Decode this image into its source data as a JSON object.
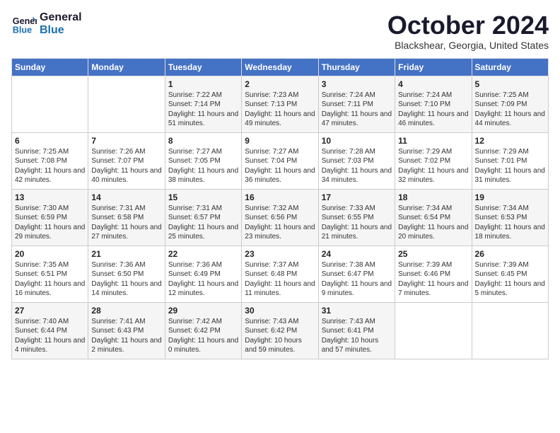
{
  "header": {
    "logo_line1": "General",
    "logo_line2": "Blue",
    "month_title": "October 2024",
    "location": "Blackshear, Georgia, United States"
  },
  "days_of_week": [
    "Sunday",
    "Monday",
    "Tuesday",
    "Wednesday",
    "Thursday",
    "Friday",
    "Saturday"
  ],
  "weeks": [
    [
      {
        "day": "",
        "info": ""
      },
      {
        "day": "",
        "info": ""
      },
      {
        "day": "1",
        "info": "Sunrise: 7:22 AM\nSunset: 7:14 PM\nDaylight: 11 hours and 51 minutes."
      },
      {
        "day": "2",
        "info": "Sunrise: 7:23 AM\nSunset: 7:13 PM\nDaylight: 11 hours and 49 minutes."
      },
      {
        "day": "3",
        "info": "Sunrise: 7:24 AM\nSunset: 7:11 PM\nDaylight: 11 hours and 47 minutes."
      },
      {
        "day": "4",
        "info": "Sunrise: 7:24 AM\nSunset: 7:10 PM\nDaylight: 11 hours and 46 minutes."
      },
      {
        "day": "5",
        "info": "Sunrise: 7:25 AM\nSunset: 7:09 PM\nDaylight: 11 hours and 44 minutes."
      }
    ],
    [
      {
        "day": "6",
        "info": "Sunrise: 7:25 AM\nSunset: 7:08 PM\nDaylight: 11 hours and 42 minutes."
      },
      {
        "day": "7",
        "info": "Sunrise: 7:26 AM\nSunset: 7:07 PM\nDaylight: 11 hours and 40 minutes."
      },
      {
        "day": "8",
        "info": "Sunrise: 7:27 AM\nSunset: 7:05 PM\nDaylight: 11 hours and 38 minutes."
      },
      {
        "day": "9",
        "info": "Sunrise: 7:27 AM\nSunset: 7:04 PM\nDaylight: 11 hours and 36 minutes."
      },
      {
        "day": "10",
        "info": "Sunrise: 7:28 AM\nSunset: 7:03 PM\nDaylight: 11 hours and 34 minutes."
      },
      {
        "day": "11",
        "info": "Sunrise: 7:29 AM\nSunset: 7:02 PM\nDaylight: 11 hours and 32 minutes."
      },
      {
        "day": "12",
        "info": "Sunrise: 7:29 AM\nSunset: 7:01 PM\nDaylight: 11 hours and 31 minutes."
      }
    ],
    [
      {
        "day": "13",
        "info": "Sunrise: 7:30 AM\nSunset: 6:59 PM\nDaylight: 11 hours and 29 minutes."
      },
      {
        "day": "14",
        "info": "Sunrise: 7:31 AM\nSunset: 6:58 PM\nDaylight: 11 hours and 27 minutes."
      },
      {
        "day": "15",
        "info": "Sunrise: 7:31 AM\nSunset: 6:57 PM\nDaylight: 11 hours and 25 minutes."
      },
      {
        "day": "16",
        "info": "Sunrise: 7:32 AM\nSunset: 6:56 PM\nDaylight: 11 hours and 23 minutes."
      },
      {
        "day": "17",
        "info": "Sunrise: 7:33 AM\nSunset: 6:55 PM\nDaylight: 11 hours and 21 minutes."
      },
      {
        "day": "18",
        "info": "Sunrise: 7:34 AM\nSunset: 6:54 PM\nDaylight: 11 hours and 20 minutes."
      },
      {
        "day": "19",
        "info": "Sunrise: 7:34 AM\nSunset: 6:53 PM\nDaylight: 11 hours and 18 minutes."
      }
    ],
    [
      {
        "day": "20",
        "info": "Sunrise: 7:35 AM\nSunset: 6:51 PM\nDaylight: 11 hours and 16 minutes."
      },
      {
        "day": "21",
        "info": "Sunrise: 7:36 AM\nSunset: 6:50 PM\nDaylight: 11 hours and 14 minutes."
      },
      {
        "day": "22",
        "info": "Sunrise: 7:36 AM\nSunset: 6:49 PM\nDaylight: 11 hours and 12 minutes."
      },
      {
        "day": "23",
        "info": "Sunrise: 7:37 AM\nSunset: 6:48 PM\nDaylight: 11 hours and 11 minutes."
      },
      {
        "day": "24",
        "info": "Sunrise: 7:38 AM\nSunset: 6:47 PM\nDaylight: 11 hours and 9 minutes."
      },
      {
        "day": "25",
        "info": "Sunrise: 7:39 AM\nSunset: 6:46 PM\nDaylight: 11 hours and 7 minutes."
      },
      {
        "day": "26",
        "info": "Sunrise: 7:39 AM\nSunset: 6:45 PM\nDaylight: 11 hours and 5 minutes."
      }
    ],
    [
      {
        "day": "27",
        "info": "Sunrise: 7:40 AM\nSunset: 6:44 PM\nDaylight: 11 hours and 4 minutes."
      },
      {
        "day": "28",
        "info": "Sunrise: 7:41 AM\nSunset: 6:43 PM\nDaylight: 11 hours and 2 minutes."
      },
      {
        "day": "29",
        "info": "Sunrise: 7:42 AM\nSunset: 6:42 PM\nDaylight: 11 hours and 0 minutes."
      },
      {
        "day": "30",
        "info": "Sunrise: 7:43 AM\nSunset: 6:42 PM\nDaylight: 10 hours and 59 minutes."
      },
      {
        "day": "31",
        "info": "Sunrise: 7:43 AM\nSunset: 6:41 PM\nDaylight: 10 hours and 57 minutes."
      },
      {
        "day": "",
        "info": ""
      },
      {
        "day": "",
        "info": ""
      }
    ]
  ]
}
